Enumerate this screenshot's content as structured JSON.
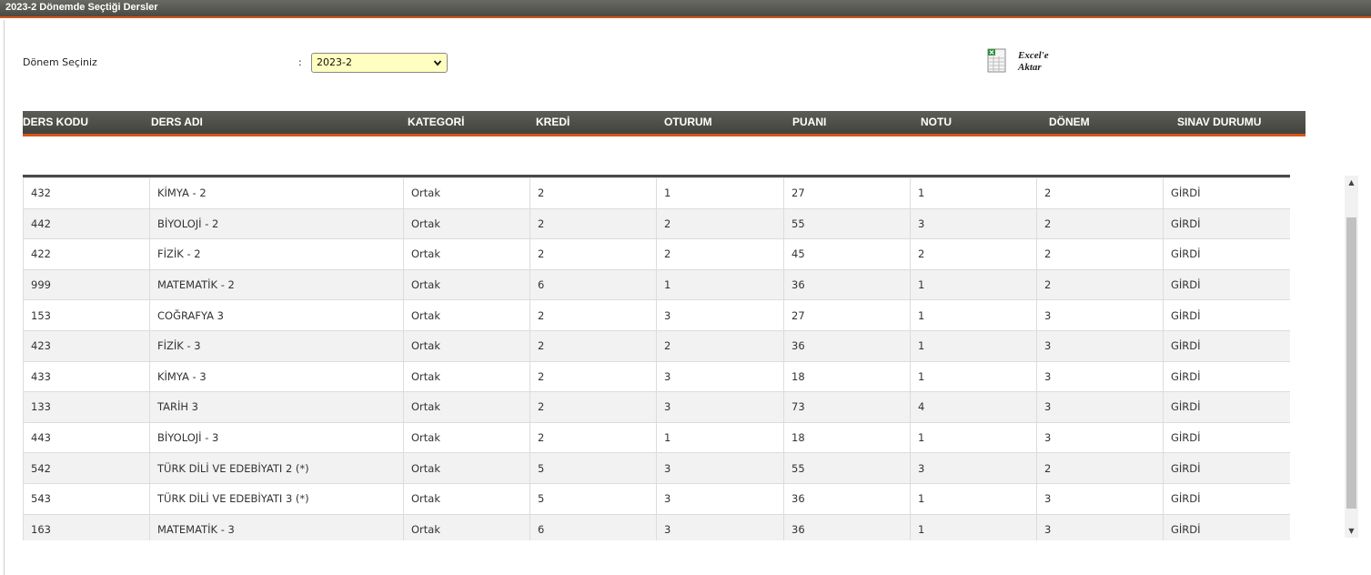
{
  "window": {
    "title": "2023-2 Dönemde Seçtiği Dersler"
  },
  "filter": {
    "label": "Dönem Seçiniz",
    "colon": ":",
    "selected": "2023-2"
  },
  "export": {
    "line1": "Excel'e",
    "line2": "Aktar",
    "icon": "excel-icon"
  },
  "table": {
    "headers": [
      "DERS KODU",
      "DERS ADI",
      "KATEGORİ",
      "KREDİ",
      "OTURUM",
      "PUANI",
      "NOTU",
      "DÖNEM",
      "SINAV DURUMU"
    ],
    "rows": [
      [
        "432",
        "KİMYA - 2",
        "Ortak",
        "2",
        "1",
        "27",
        "1",
        "2",
        "GİRDİ"
      ],
      [
        "442",
        "BİYOLOJİ - 2",
        "Ortak",
        "2",
        "2",
        "55",
        "3",
        "2",
        "GİRDİ"
      ],
      [
        "422",
        "FİZİK - 2",
        "Ortak",
        "2",
        "2",
        "45",
        "2",
        "2",
        "GİRDİ"
      ],
      [
        "999",
        "MATEMATİK - 2",
        "Ortak",
        "6",
        "1",
        "36",
        "1",
        "2",
        "GİRDİ"
      ],
      [
        "153",
        "COĞRAFYA 3",
        "Ortak",
        "2",
        "3",
        "27",
        "1",
        "3",
        "GİRDİ"
      ],
      [
        "423",
        "FİZİK - 3",
        "Ortak",
        "2",
        "2",
        "36",
        "1",
        "3",
        "GİRDİ"
      ],
      [
        "433",
        "KİMYA - 3",
        "Ortak",
        "2",
        "3",
        "18",
        "1",
        "3",
        "GİRDİ"
      ],
      [
        "133",
        "TARİH 3",
        "Ortak",
        "2",
        "3",
        "73",
        "4",
        "3",
        "GİRDİ"
      ],
      [
        "443",
        "BİYOLOJİ - 3",
        "Ortak",
        "2",
        "1",
        "18",
        "1",
        "3",
        "GİRDİ"
      ],
      [
        "542",
        "TÜRK DİLİ VE EDEBİYATI 2 (*)",
        "Ortak",
        "5",
        "3",
        "55",
        "3",
        "2",
        "GİRDİ"
      ],
      [
        "543",
        "TÜRK DİLİ VE EDEBİYATI 3 (*)",
        "Ortak",
        "5",
        "3",
        "36",
        "1",
        "3",
        "GİRDİ"
      ],
      [
        "163",
        "MATEMATİK - 3",
        "Ortak",
        "6",
        "3",
        "36",
        "1",
        "3",
        "GİRDİ"
      ]
    ]
  },
  "colors": {
    "accent": "#d2571c",
    "header": "#4a4a45",
    "select_bg": "#ffffc0"
  }
}
